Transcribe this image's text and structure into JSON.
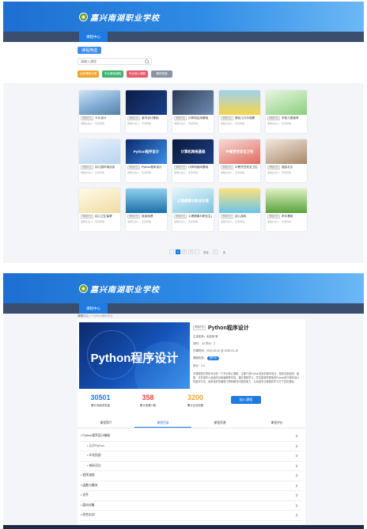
{
  "site": {
    "logo_text": "嘉兴南湖职业学校",
    "nav_label": "课程中心"
  },
  "list_page": {
    "filter_title": "课程筛选",
    "search_placeholder": "请输入课程",
    "categories": [
      {
        "label": "全部课程分类",
        "color": "#f0a52b"
      },
      {
        "label": "专业基础课程",
        "color": "#3cb46e"
      },
      {
        "label": "专业核心课程",
        "color": "#e9576a"
      },
      {
        "label": "素质拓展",
        "color": "#8a92a4"
      }
    ],
    "courses": [
      {
        "tag": "课程标签",
        "title": "卡片设计",
        "meta": "课程负责人：毛老师等",
        "bg": "linear-gradient(160deg,#cfe3f5 0%,#7aa6cf 60%,#5c7fa6 100%)",
        "thumb_text": ""
      },
      {
        "tag": "课程标签",
        "title": "室内设计基础",
        "meta": "课程负责人：毛老师等",
        "bg": "linear-gradient(135deg,#0b1d45 0%,#1c3f8a 100%)",
        "thumb_text": ""
      },
      {
        "tag": "课程标签",
        "title": "计算机应用基础",
        "meta": "课程负责人：毛老师等",
        "bg": "linear-gradient(135deg,#2b3a55 0%,#6f8cb3 100%)",
        "thumb_text": ""
      },
      {
        "tag": "课程标签",
        "title": "婴幼儿行为观察",
        "meta": "课程负责人：毛老师等",
        "bg": "linear-gradient(180deg,#9ed2ef 0%,#f6d44a 100%)",
        "thumb_text": ""
      },
      {
        "tag": "课程标签",
        "title": "学前儿童营养",
        "meta": "课程负责人：毛老师等",
        "bg": "linear-gradient(160deg,#e8f5e4 0%,#8ccf7c 100%)",
        "thumb_text": ""
      },
      {
        "tag": "课程标签",
        "title": "幼儿园环境创设",
        "meta": "课程负责人：毛老师等",
        "bg": "linear-gradient(160deg,#e9f2fb 0%,#b7d3f0 100%)",
        "thumb_text": ""
      },
      {
        "tag": "课程标签",
        "title": "Python程序设计",
        "meta": "课程负责人：毛老师等",
        "bg": "linear-gradient(135deg,#0d2a6e 0%,#3b8ee8 100%)",
        "thumb_text": "Python程序设计"
      },
      {
        "tag": "课程标签",
        "title": "计算机组网基础",
        "meta": "课程负责人：毛老师等",
        "bg": "linear-gradient(135deg,#0b1838 0%,#1d3f86 100%)",
        "thumb_text": "计算机网络基础"
      },
      {
        "tag": "课程标签",
        "title": "中餐烹饪安全卫生",
        "meta": "课程负责人：毛老师等",
        "bg": "linear-gradient(160deg,#f7d9d6 0%,#e06b5e 100%)",
        "thumb_text": "中餐烹饪安全卫生"
      },
      {
        "tag": "课程标签",
        "title": "酒店礼仪",
        "meta": "课程负责人：毛老师等",
        "bg": "linear-gradient(160deg,#f2e8dc 0%,#a8876a 100%)",
        "thumb_text": ""
      },
      {
        "tag": "课程标签",
        "title": "幼儿卫生保健",
        "meta": "课程负责人：毛老师等",
        "bg": "linear-gradient(160deg,#fffbe8 0%,#f0dca2 100%)",
        "thumb_text": ""
      },
      {
        "tag": "课程标签",
        "title": "旅游地理",
        "meta": "课程负责人：毛老师等",
        "bg": "linear-gradient(180deg,#8fd0ef 0%,#1b6fa8 100%)",
        "thumb_text": ""
      },
      {
        "tag": "课程标签",
        "title": "心理健康与职业生涯",
        "meta": "课程负责人：毛老师等",
        "bg": "linear-gradient(160deg,#e6f6fb 0%,#7bc3e0 100%)",
        "thumb_text": "心理健康与职业生涯"
      },
      {
        "tag": "课程标签",
        "title": "幼儿游戏",
        "meta": "课程负责人：毛老师等",
        "bg": "linear-gradient(180deg,#fbe27a 0%,#6ac4ea 100%)",
        "thumb_text": ""
      },
      {
        "tag": "课程标签",
        "title": "声乐基础",
        "meta": "课程负责人：毛老师等",
        "bg": "linear-gradient(180deg,#dff0c5 0%,#5aa33c 100%)",
        "thumb_text": ""
      }
    ],
    "pagination": {
      "prev": "‹",
      "pages": [
        "1",
        "2",
        "3"
      ],
      "active_index": 0,
      "next": "›",
      "goto_label": "前往",
      "goto_value": "1",
      "page_suffix": "页"
    }
  },
  "detail_page": {
    "breadcrumb": {
      "home": "课程中心",
      "sep": "/",
      "current": "Python程序设计"
    },
    "cover_title": "Python程序设计",
    "tag": "课程标签",
    "course_name": "Python程序设计",
    "teachers": "主讲老师：毛老师 等",
    "hours": "学时：  32   学分：2",
    "period": "开课时间：2024-09-02 至 2025-01-15",
    "status_label": "课程状态：",
    "status_value": "进行中",
    "credits": "学分：2.0",
    "description": "本课程是计算机专业的一门专业核心课程，主要介绍Python语言的基本语法、程序控制结构、函数、文件操作以及面向对象编程等内容。通过课程学习，学生能够掌握使用Python进行程序设计的基本方法，培养良好的编程习惯和解决问题的能力，为后续专业课程的学习打下坚实基础。",
    "stats": [
      {
        "num": "30501",
        "label": "累计页面浏览量",
        "color": "#1f7be0"
      },
      {
        "num": "358",
        "label": "累计选课人数",
        "color": "#e8453c"
      },
      {
        "num": "3200",
        "label": "累计互动次数",
        "color": "#f0a52b"
      }
    ],
    "join_label": "加入课程",
    "tabs": [
      "课程简介",
      "课程目录",
      "课程资源",
      "课程评价"
    ],
    "active_tab": 1,
    "chapters": [
      {
        "label": "• Python程序设计基础",
        "sub": false
      },
      {
        "label": "• 认识Python",
        "sub": true
      },
      {
        "label": "• 环境搭建",
        "sub": true
      },
      {
        "label": "• 基础语法",
        "sub": true
      },
      {
        "label": "• 程序流程",
        "sub": false
      },
      {
        "label": "• 函数与模块",
        "sub": false
      },
      {
        "label": "• 文件",
        "sub": false
      },
      {
        "label": "• 面向对象",
        "sub": false
      },
      {
        "label": "• 综合实训",
        "sub": false
      }
    ]
  }
}
